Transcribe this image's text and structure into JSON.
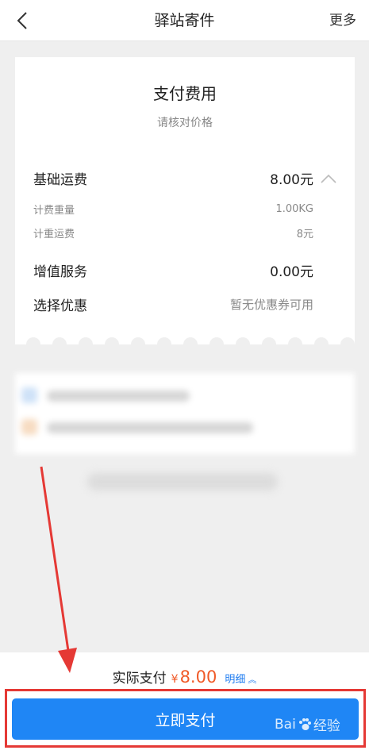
{
  "header": {
    "title": "驿站寄件",
    "more_label": "更多"
  },
  "payment_card": {
    "title": "支付费用",
    "subtitle": "请核对价格",
    "base_fee": {
      "label": "基础运费",
      "value": "8.00元"
    },
    "weight": {
      "label": "计费重量",
      "value": "1.00KG"
    },
    "weight_fee": {
      "label": "计重运费",
      "value": "8元"
    },
    "value_added": {
      "label": "增值服务",
      "value": "0.00元"
    },
    "discount": {
      "label": "选择优惠",
      "value": "暂无优惠券可用"
    }
  },
  "bottom_bar": {
    "actual_pay_label": "实际支付",
    "currency": "¥",
    "amount": "8.00",
    "detail_label": "明细",
    "pay_button_label": "立即支付"
  },
  "watermark": {
    "brand_text": "Bai",
    "brand_suffix": "经验"
  },
  "colors": {
    "accent_blue": "#1f86f5",
    "price_orange": "#f05a28",
    "highlight_red": "#e53935"
  },
  "icons": {
    "back": "chevron-left-icon",
    "collapse": "chevron-up-icon",
    "detail": "double-chevron-up-icon",
    "watermark": "paw-icon"
  }
}
